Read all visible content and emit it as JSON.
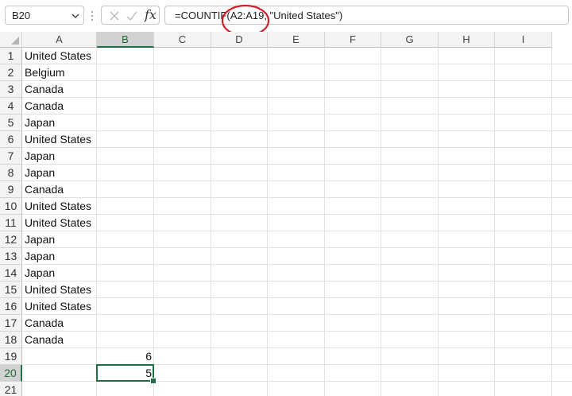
{
  "formula_bar": {
    "name_box": "B20",
    "fx_label": "fx",
    "formula": "=COUNTIF(A2:A19, \"United States\")"
  },
  "columns": [
    "A",
    "B",
    "C",
    "D",
    "E",
    "F",
    "G",
    "H",
    "I"
  ],
  "rows": [
    "1",
    "2",
    "3",
    "4",
    "5",
    "6",
    "7",
    "8",
    "9",
    "10",
    "11",
    "12",
    "13",
    "14",
    "15",
    "16",
    "17",
    "18",
    "19",
    "20",
    "21"
  ],
  "selection": {
    "column": "B",
    "row": "20"
  },
  "column_a": [
    "United States",
    "Belgium",
    "Canada",
    "Canada",
    "Japan",
    "United States",
    "Japan",
    "Japan",
    "Canada",
    "United States",
    "United States",
    "Japan",
    "Japan",
    "Japan",
    "United States",
    "United States",
    "Canada",
    "Canada"
  ],
  "column_b": {
    "b19": "6",
    "b20": "5"
  },
  "colors": {
    "selection": "#1e7145",
    "annotation": "#d0202a",
    "gridline": "#e1e1e1",
    "header_bg": "#f3f3f3"
  }
}
